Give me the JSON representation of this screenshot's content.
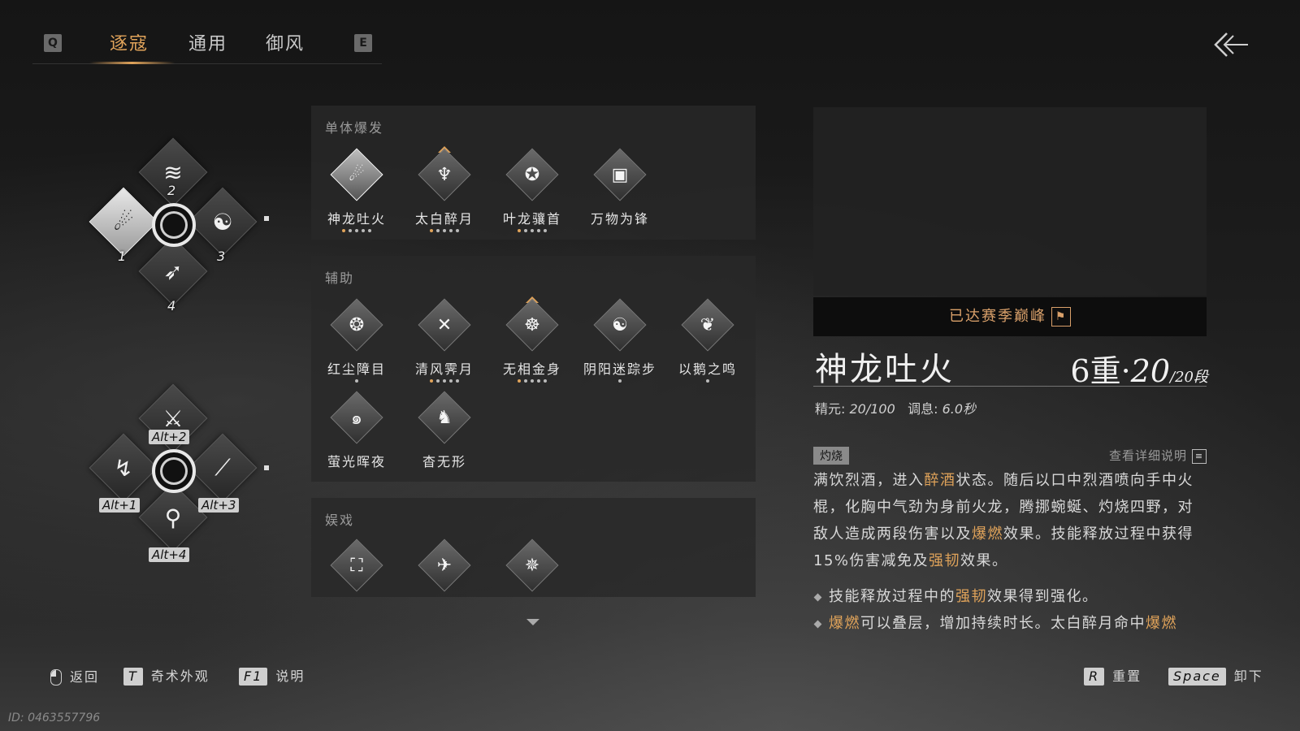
{
  "tabs": {
    "prev_key": "Q",
    "next_key": "E",
    "items": [
      "逐寇",
      "通用",
      "御风"
    ],
    "active_index": 0
  },
  "loadout": {
    "group1": {
      "slots": [
        {
          "label": "1",
          "icon": "dragon-fire-icon"
        },
        {
          "label": "2",
          "icon": "swirl-icon"
        },
        {
          "label": "3",
          "icon": "meditate-icon"
        },
        {
          "label": "4",
          "icon": "feather-icon"
        }
      ]
    },
    "group2": {
      "slots": [
        {
          "label": "Alt",
          "plus": "+",
          "num": "1",
          "icon": "leap-icon"
        },
        {
          "label": "Alt",
          "plus": "+",
          "num": "2",
          "icon": "stance-icon"
        },
        {
          "label": "Alt",
          "plus": "+",
          "num": "3",
          "icon": "blade-icon"
        },
        {
          "label": "Alt",
          "plus": "+",
          "num": "4",
          "icon": "kneel-icon"
        }
      ]
    }
  },
  "categories": [
    {
      "title": "单体爆发",
      "skills": [
        {
          "name": "神龙吐火",
          "dots": 5,
          "on": 1,
          "selected": true
        },
        {
          "name": "太白醉月",
          "dots": 5,
          "on": 1,
          "marker": true
        },
        {
          "name": "叶龙骧首",
          "dots": 5,
          "on": 1
        },
        {
          "name": "万物为锋",
          "dots": 0,
          "on": 0
        }
      ]
    },
    {
      "title": "辅助",
      "skills": [
        {
          "name": "红尘障目",
          "dots": 1,
          "on": 0
        },
        {
          "name": "清风霁月",
          "dots": 5,
          "on": 1
        },
        {
          "name": "无相金身",
          "dots": 5,
          "on": 1,
          "marker": true
        },
        {
          "name": "阴阳迷踪步",
          "dots": 1,
          "on": 0
        },
        {
          "name": "以鹅之鸣",
          "dots": 1,
          "on": 0
        },
        {
          "name": "萤光晖夜",
          "dots": 0,
          "on": 0
        },
        {
          "name": "杳无形",
          "dots": 0,
          "on": 0
        }
      ]
    },
    {
      "title": "娱戏",
      "skills": [
        {
          "name": "",
          "dots": 0,
          "on": 0
        },
        {
          "name": "",
          "dots": 0,
          "on": 0
        },
        {
          "name": "",
          "dots": 0,
          "on": 0
        }
      ]
    }
  ],
  "detail": {
    "peak_text": "已达赛季巅峰",
    "skill_name": "神龙吐火",
    "level_major": "6重",
    "level_sep": "·",
    "level_cur": "20",
    "level_max": "/20段",
    "stat1_label": "精元:",
    "stat1_value": "20/100",
    "stat2_label": "调息:",
    "stat2_value": "6.0秒",
    "tag": "灼烧",
    "view_detail": "查看详细说明",
    "desc_parts": [
      {
        "t": "满饮烈酒，进入",
        "hl": false
      },
      {
        "t": "醉酒",
        "hl": true
      },
      {
        "t": "状态。随后以口中烈酒喷向手中火棍，化胸中气劲为身前火龙，腾挪蜿蜒、灼烧四野，对敌人造成两段伤害以及",
        "hl": false
      },
      {
        "t": "爆燃",
        "hl": true
      },
      {
        "t": "效果。技能释放过程中获得15%伤害减免及",
        "hl": false
      },
      {
        "t": "强韧",
        "hl": true
      },
      {
        "t": "效果。",
        "hl": false
      }
    ],
    "bullet1": [
      {
        "t": "技能释放过程中的",
        "hl": false
      },
      {
        "t": "强韧",
        "hl": true
      },
      {
        "t": "效果得到强化。",
        "hl": false
      }
    ],
    "bullet2": [
      {
        "t": "爆燃",
        "hl": true
      },
      {
        "t": "可以叠层，增加持续时长。太白醉月命中",
        "hl": false
      },
      {
        "t": "爆燃",
        "hl": true
      }
    ]
  },
  "bottom": {
    "back_label": "返回",
    "appearance_key": "T",
    "appearance_label": "奇术外观",
    "help_key": "F1",
    "help_label": "说明",
    "reset_key": "R",
    "reset_label": "重置",
    "unequip_key": "Space",
    "unequip_label": "卸下"
  },
  "id_text": "ID: 0463557796",
  "colors": {
    "accent": "#e0a35a",
    "panel": "#282828"
  }
}
